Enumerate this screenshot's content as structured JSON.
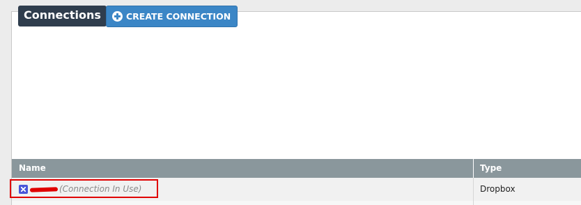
{
  "header": {
    "title": "Connections",
    "create_button_label": "CREATE CONNECTION",
    "create_button_icon": "plus-circle-icon"
  },
  "table": {
    "columns": [
      "Name",
      "Type"
    ],
    "rows": [
      {
        "name_icon": "dropbox-icon",
        "name_status": "(Connection In Use)",
        "type": "Dropbox"
      }
    ]
  },
  "colors": {
    "title_bg": "#2f3d4d",
    "button_bg": "#3b86c6",
    "header_bg": "#8a979c",
    "highlight": "#e00000"
  }
}
